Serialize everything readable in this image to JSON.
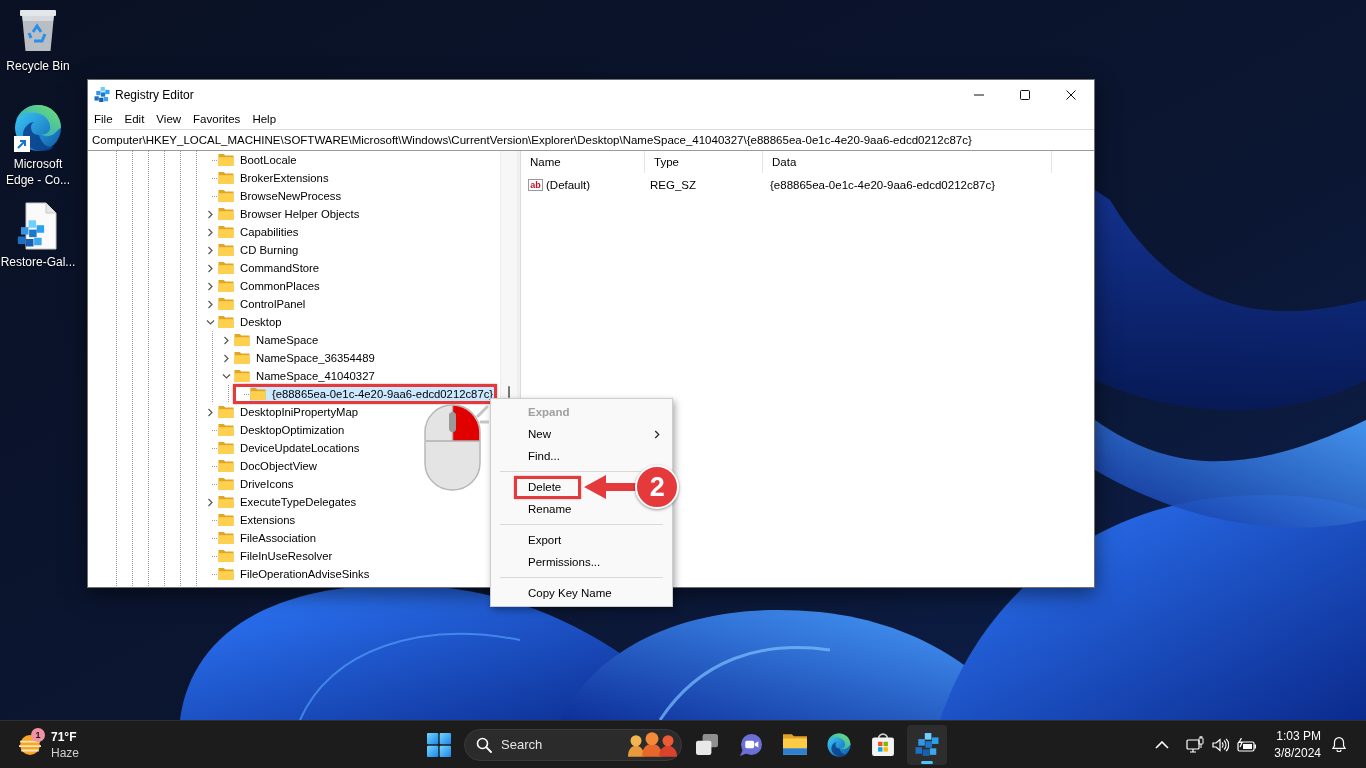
{
  "desktop": {
    "icons": [
      {
        "kind": "recycle-bin",
        "label": "Recycle Bin"
      },
      {
        "kind": "edge-shortcut",
        "label": "Microsoft Edge - Co..."
      },
      {
        "kind": "registry-file",
        "label": "Restore-Gal..."
      }
    ]
  },
  "window": {
    "title": "Registry Editor",
    "menu": [
      "File",
      "Edit",
      "View",
      "Favorites",
      "Help"
    ],
    "address": "Computer\\HKEY_LOCAL_MACHINE\\SOFTWARE\\Microsoft\\Windows\\CurrentVersion\\Explorer\\Desktop\\NameSpace_41040327\\{e88865ea-0e1c-4e20-9aa6-edcd0212c87c}",
    "tree": [
      {
        "label": "BootLocale",
        "has_subkeys": false,
        "expanded": false,
        "selected": false
      },
      {
        "label": "BrokerExtensions",
        "has_subkeys": false,
        "expanded": false,
        "selected": false
      },
      {
        "label": "BrowseNewProcess",
        "has_subkeys": false,
        "expanded": false,
        "selected": false
      },
      {
        "label": "Browser Helper Objects",
        "has_subkeys": true,
        "expanded": false,
        "selected": false
      },
      {
        "label": "Capabilities",
        "has_subkeys": true,
        "expanded": false,
        "selected": false
      },
      {
        "label": "CD Burning",
        "has_subkeys": true,
        "expanded": false,
        "selected": false
      },
      {
        "label": "CommandStore",
        "has_subkeys": true,
        "expanded": false,
        "selected": false
      },
      {
        "label": "CommonPlaces",
        "has_subkeys": true,
        "expanded": false,
        "selected": false
      },
      {
        "label": "ControlPanel",
        "has_subkeys": true,
        "expanded": false,
        "selected": false
      },
      {
        "label": "Desktop",
        "has_subkeys": true,
        "expanded": true,
        "selected": false,
        "children": [
          {
            "label": "NameSpace",
            "has_subkeys": true,
            "expanded": false,
            "selected": false
          },
          {
            "label": "NameSpace_36354489",
            "has_subkeys": true,
            "expanded": false,
            "selected": false
          },
          {
            "label": "NameSpace_41040327",
            "has_subkeys": true,
            "expanded": true,
            "selected": false,
            "children": [
              {
                "label": "{e88865ea-0e1c-4e20-9aa6-edcd0212c87c}",
                "has_subkeys": false,
                "expanded": false,
                "selected": true
              }
            ]
          }
        ]
      },
      {
        "label": "DesktopIniPropertyMap",
        "has_subkeys": true,
        "expanded": false,
        "selected": false
      },
      {
        "label": "DesktopOptimization",
        "has_subkeys": false,
        "expanded": false,
        "selected": false
      },
      {
        "label": "DeviceUpdateLocations",
        "has_subkeys": false,
        "expanded": false,
        "selected": false
      },
      {
        "label": "DocObjectView",
        "has_subkeys": false,
        "expanded": false,
        "selected": false
      },
      {
        "label": "DriveIcons",
        "has_subkeys": false,
        "expanded": false,
        "selected": false
      },
      {
        "label": "ExecuteTypeDelegates",
        "has_subkeys": true,
        "expanded": false,
        "selected": false
      },
      {
        "label": "Extensions",
        "has_subkeys": false,
        "expanded": false,
        "selected": false
      },
      {
        "label": "FileAssociation",
        "has_subkeys": false,
        "expanded": false,
        "selected": false
      },
      {
        "label": "FileInUseResolver",
        "has_subkeys": false,
        "expanded": false,
        "selected": false
      },
      {
        "label": "FileOperationAdviseSinks",
        "has_subkeys": false,
        "expanded": false,
        "selected": false
      }
    ],
    "values": {
      "columns": [
        "Name",
        "Type",
        "Data"
      ],
      "rows": [
        {
          "icon_text": "ab",
          "name": "(Default)",
          "type": "REG_SZ",
          "data": "{e88865ea-0e1c-4e20-9aa6-edcd0212c87c}"
        }
      ]
    }
  },
  "context_menu": {
    "items": [
      {
        "kind": "item",
        "label": "Expand",
        "disabled": true,
        "default": true,
        "submenu": false,
        "marked": false
      },
      {
        "kind": "item",
        "label": "New",
        "disabled": false,
        "default": false,
        "submenu": true,
        "marked": false
      },
      {
        "kind": "item",
        "label": "Find...",
        "disabled": false,
        "default": false,
        "submenu": false,
        "marked": false
      },
      {
        "kind": "separator"
      },
      {
        "kind": "item",
        "label": "Delete",
        "disabled": false,
        "default": false,
        "submenu": false,
        "marked": true
      },
      {
        "kind": "item",
        "label": "Rename",
        "disabled": false,
        "default": false,
        "submenu": false,
        "marked": false
      },
      {
        "kind": "separator"
      },
      {
        "kind": "item",
        "label": "Export",
        "disabled": false,
        "default": false,
        "submenu": false,
        "marked": false
      },
      {
        "kind": "item",
        "label": "Permissions...",
        "disabled": false,
        "default": false,
        "submenu": false,
        "marked": false
      },
      {
        "kind": "separator"
      },
      {
        "kind": "item",
        "label": "Copy Key Name",
        "disabled": false,
        "default": false,
        "submenu": false,
        "marked": false
      }
    ]
  },
  "callout": {
    "number": "2"
  },
  "taskbar": {
    "weather": {
      "badge": "1",
      "temperature": "71°F",
      "condition": "Haze"
    },
    "search": {
      "placeholder": "Search"
    },
    "apps": [
      {
        "kind": "task-view",
        "active": false
      },
      {
        "kind": "chat",
        "active": false
      },
      {
        "kind": "file-explorer",
        "active": false
      },
      {
        "kind": "edge",
        "active": false
      },
      {
        "kind": "store",
        "active": false
      },
      {
        "kind": "registry-editor",
        "active": true
      }
    ],
    "clock": {
      "time": "1:03 PM",
      "date": "3/8/2024"
    }
  }
}
